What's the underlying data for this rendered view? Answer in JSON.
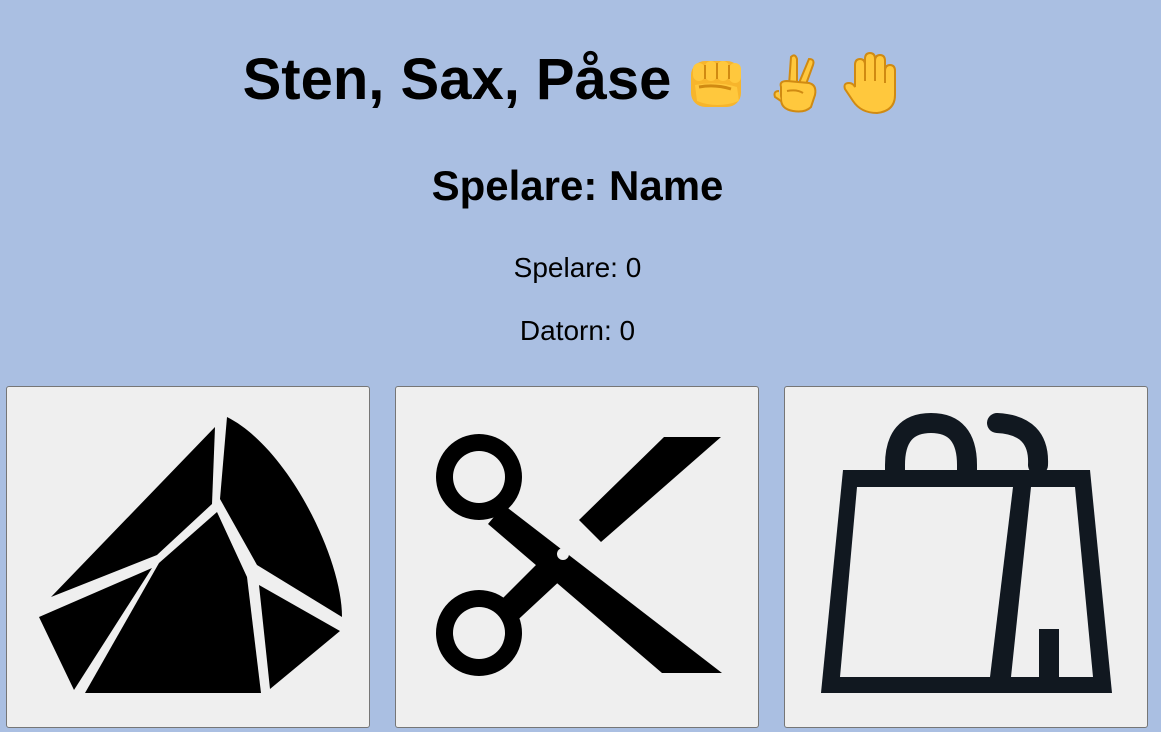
{
  "header": {
    "title": "Sten, Sax, Påse",
    "emojis": [
      "fist-icon",
      "victory-hand-icon",
      "raised-hand-icon"
    ]
  },
  "player": {
    "heading": "Spelare: Name"
  },
  "scores": {
    "player": "Spelare: 0",
    "computer": "Datorn: 0"
  },
  "choices": [
    {
      "name": "rock-button",
      "icon": "rock-icon"
    },
    {
      "name": "scissors-button",
      "icon": "scissors-icon"
    },
    {
      "name": "bag-button",
      "icon": "shopping-bag-icon"
    }
  ],
  "colors": {
    "background": "#aabfe2",
    "button_background": "#efefef",
    "bag_stroke": "#111820",
    "emoji_yellow": "#ffc83d"
  }
}
